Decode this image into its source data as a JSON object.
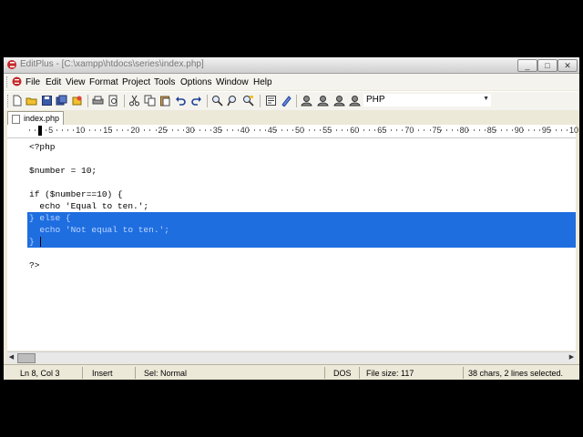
{
  "window": {
    "title": "EditPlus - [C:\\xampp\\htdocs\\series\\index.php]",
    "controls": [
      "_",
      "□",
      "✕"
    ]
  },
  "menu": {
    "items": [
      "File",
      "Edit",
      "View",
      "Format",
      "Project",
      "Tools",
      "Options",
      "Window",
      "Help"
    ]
  },
  "toolbar": {
    "language": "PHP",
    "buttons": [
      "new-document",
      "open-file",
      "save",
      "save-all",
      "open-remote",
      "print",
      "print-preview",
      "cut",
      "copy",
      "paste",
      "delete",
      "undo",
      "redo",
      "find",
      "find-next",
      "replace",
      "word-wrap",
      "spellcheck",
      "cliptext",
      "user-tool-1",
      "user-tool-2",
      "user-tool-3",
      "user-tool-4"
    ]
  },
  "tabs": [
    {
      "label": "index.php",
      "active": true
    }
  ],
  "ruler": {
    "labels": [
      "5",
      "10",
      "15",
      "20",
      "25",
      "30",
      "35",
      "40",
      "45",
      "50",
      "55",
      "60",
      "65",
      "70",
      "75",
      "80",
      "85",
      "90",
      "95",
      "10"
    ]
  },
  "editor": {
    "lines": [
      "<?php",
      "",
      "$number = 10;",
      "",
      "if ($number==10) {",
      "  echo 'Equal to ten.';",
      "} else {",
      "  echo 'Not equal to ten.';",
      "}",
      "",
      "?>"
    ],
    "selected_lines": [
      6,
      7,
      8
    ],
    "selection_color": "#1f6ee0"
  },
  "status": {
    "position": "Ln 8, Col 3",
    "mode": "Insert",
    "selection_mode": "Sel: Normal",
    "line_ending": "DOS",
    "file_size": "File size: 117",
    "selection_info": "38 chars, 2 lines selected."
  }
}
